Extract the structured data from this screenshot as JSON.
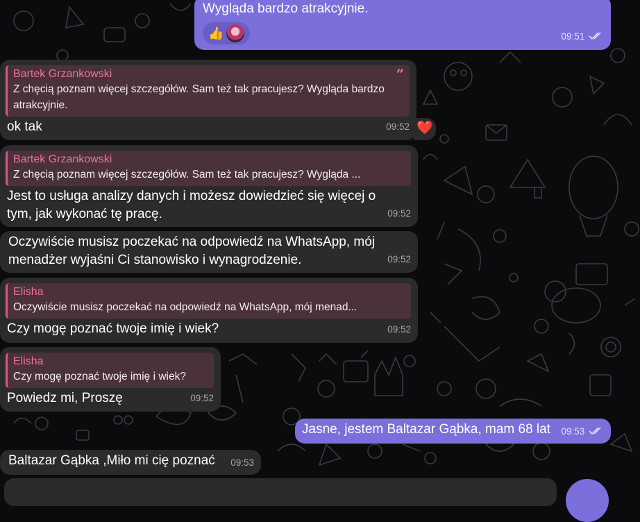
{
  "colors": {
    "background": "#0b0b0d",
    "incoming_bubble": "#2b2b2d",
    "outgoing_bubble": "#7b6fdc",
    "reply_accent": "#e0528c",
    "reaction_heart": "#ff2d3a"
  },
  "messages": [
    {
      "id": "m0",
      "direction": "out",
      "text": "Wygląda bardzo atrakcyjnie.",
      "time": "09:51",
      "reactions": [
        "thumbs-up-emoji",
        "avatar"
      ],
      "read": true
    },
    {
      "id": "m1",
      "direction": "in",
      "reply_author": "Bartek Grzankowski",
      "reply_text": "Z chęcią poznam więcej szczegółów. Sam też tak pracujesz? Wygląda bardzo atrakcyjnie.",
      "text": "ok tak",
      "time": "09:52",
      "reaction": "heart-emoji"
    },
    {
      "id": "m2",
      "direction": "in",
      "reply_author": "Bartek Grzankowski",
      "reply_text": "Z chęcią poznam więcej szczegółów. Sam też tak pracujesz? Wygląda ...",
      "text": "Jest to usługa analizy danych i możesz dowiedzieć się więcej o tym, jak wykonać tę pracę.",
      "time": "09:52"
    },
    {
      "id": "m3",
      "direction": "in",
      "text": "Oczywiście musisz poczekać na odpowiedź na WhatsApp, mój menadżer wyjaśni Ci stanowisko i wynagrodzenie.",
      "time": "09:52"
    },
    {
      "id": "m4",
      "direction": "in",
      "reply_author": "Elisha",
      "reply_text": "Oczywiście musisz poczekać na odpowiedź na WhatsApp, mój menad...",
      "text": "Czy mogę poznać twoje imię i wiek?",
      "time": "09:52"
    },
    {
      "id": "m5",
      "direction": "in",
      "reply_author": "Elisha",
      "reply_text": "Czy mogę poznać twoje imię i wiek?",
      "text": "Powiedz mi, Proszę",
      "time": "09:52"
    },
    {
      "id": "m6",
      "direction": "out",
      "text": "Jasne, jestem Baltazar Gąbka, mam 68 lat",
      "time": "09:53",
      "read": true
    },
    {
      "id": "m7",
      "direction": "in",
      "text": "Baltazar Gąbka ,Miło mi cię poznać",
      "time": "09:53"
    }
  ]
}
